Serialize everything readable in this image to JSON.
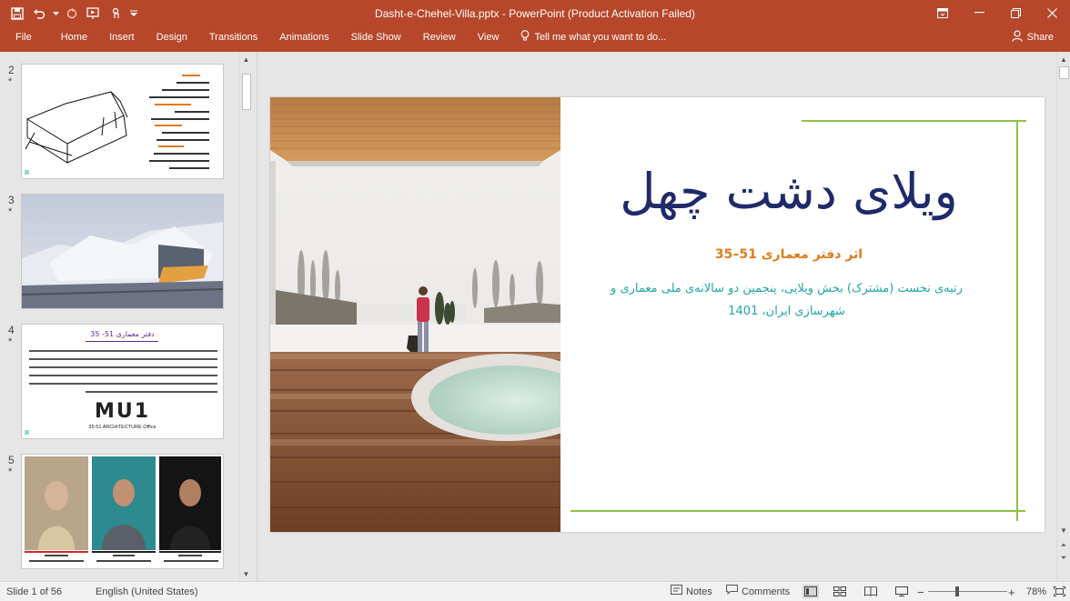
{
  "window": {
    "title": "Dasht-e-Chehel-Villa.pptx - PowerPoint (Product Activation Failed)"
  },
  "ribbon": {
    "tabs": [
      "File",
      "Home",
      "Insert",
      "Design",
      "Transitions",
      "Animations",
      "Slide Show",
      "Review",
      "View"
    ],
    "tell_me": "Tell me what you want to do...",
    "share": "Share"
  },
  "thumbnails": [
    {
      "number": "2",
      "star": "*"
    },
    {
      "number": "3",
      "star": "*"
    },
    {
      "number": "4",
      "star": "*",
      "heading": "دفتر معماری 51- 35",
      "logo": "MU1",
      "logo_sub": "35-51 ARCHITECTURE Office"
    },
    {
      "number": "5",
      "star": "*"
    }
  ],
  "slide": {
    "title": "ویلای دشت چهل",
    "subtitle": "اثر دفتر معماری 51–35",
    "body": "رتبه‌ی نخست (مشترک) بخش ویلایی، پنجمین دو سالانه‌ی ملی معماری و شهرسازی ایران، 1401",
    "accent_green": "#8bc34a",
    "title_color": "#1f2a6b",
    "subtitle_color": "#e07b1b",
    "body_color": "#20a6a6"
  },
  "status": {
    "slide_of": "Slide 1 of 56",
    "language": "English (United States)",
    "notes": "Notes",
    "comments": "Comments",
    "zoom": "78%"
  },
  "colors": {
    "brand": "#b7472a"
  }
}
